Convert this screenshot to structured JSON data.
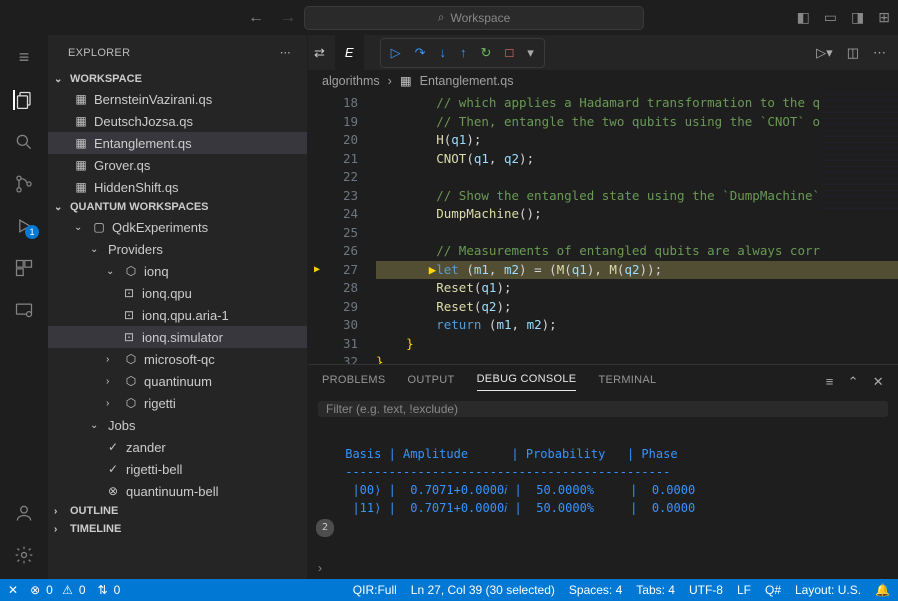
{
  "titlebar": {
    "search_placeholder": "Workspace"
  },
  "sidebar": {
    "title": "EXPLORER",
    "workspace_section": "WORKSPACE",
    "files": [
      {
        "name": "BernsteinVazirani.qs"
      },
      {
        "name": "DeutschJozsa.qs"
      },
      {
        "name": "Entanglement.qs",
        "selected": true
      },
      {
        "name": "Grover.qs"
      },
      {
        "name": "HiddenShift.qs"
      }
    ],
    "quantum_section": "QUANTUM WORKSPACES",
    "qws_root": "QdkExperiments",
    "providers_label": "Providers",
    "providers": [
      {
        "name": "ionq",
        "expanded": true,
        "children": [
          "ionq.qpu",
          "ionq.qpu.aria-1",
          "ionq.simulator"
        ],
        "selected_child": "ionq.simulator"
      },
      {
        "name": "microsoft-qc"
      },
      {
        "name": "quantinuum"
      },
      {
        "name": "rigetti"
      }
    ],
    "jobs_label": "Jobs",
    "jobs": [
      {
        "name": "zander",
        "status": "ok"
      },
      {
        "name": "rigetti-bell",
        "status": "ok"
      },
      {
        "name": "quantinuum-bell",
        "status": "fail"
      }
    ],
    "outline_label": "OUTLINE",
    "timeline_label": "TIMELINE"
  },
  "activity_badge": "1",
  "editor": {
    "tab_label": "E",
    "breadcrumb": [
      "algorithms",
      "Entanglement.qs"
    ],
    "lines": [
      {
        "n": 18,
        "html": "        <span class='tok-c'>// which applies a Hadamard transformation to the q</span>"
      },
      {
        "n": 19,
        "html": "        <span class='tok-c'>// Then, entangle the two qubits using the `CNOT` o</span>"
      },
      {
        "n": 20,
        "html": "        <span class='tok-fn'>H</span><span class='tok-p'>(</span><span class='tok-v'>q1</span><span class='tok-p'>);</span>"
      },
      {
        "n": 21,
        "html": "        <span class='tok-fn'>CNOT</span><span class='tok-p'>(</span><span class='tok-v'>q1</span><span class='tok-p'>, </span><span class='tok-v'>q2</span><span class='tok-p'>);</span>"
      },
      {
        "n": 22,
        "html": ""
      },
      {
        "n": 23,
        "html": "        <span class='tok-c'>// Show the entangled state using the `DumpMachine`</span>"
      },
      {
        "n": 24,
        "html": "        <span class='tok-fn'>DumpMachine</span><span class='tok-p'>();</span>"
      },
      {
        "n": 25,
        "html": ""
      },
      {
        "n": 26,
        "html": "        <span class='tok-c'>// Measurements of entangled qubits are always corr</span>"
      },
      {
        "n": 27,
        "hl": true,
        "bp": true,
        "html": "       <span class='tok-br'>▶</span><span class='tok-kw'>let </span><span class='tok-p'>(</span><span class='tok-v'>m1</span><span class='tok-p'>, </span><span class='tok-v'>m2</span><span class='tok-p'>) = (</span><span class='tok-fn'>M</span><span class='tok-p'>(</span><span class='tok-v'>q1</span><span class='tok-p'>), </span><span class='tok-fn'>M</span><span class='tok-p'>(</span><span class='tok-v'>q2</span><span class='tok-p'>));</span>"
      },
      {
        "n": 28,
        "html": "        <span class='tok-fn'>Reset</span><span class='tok-p'>(</span><span class='tok-v'>q1</span><span class='tok-p'>);</span>"
      },
      {
        "n": 29,
        "html": "        <span class='tok-fn'>Reset</span><span class='tok-p'>(</span><span class='tok-v'>q2</span><span class='tok-p'>);</span>"
      },
      {
        "n": 30,
        "html": "        <span class='tok-kw'>return </span><span class='tok-p'>(</span><span class='tok-v'>m1</span><span class='tok-p'>, </span><span class='tok-v'>m2</span><span class='tok-p'>);</span>"
      },
      {
        "n": 31,
        "html": "    <span class='tok-br'>}</span>"
      },
      {
        "n": 32,
        "html": "<span class='tok-br'>}</span>"
      }
    ]
  },
  "panel": {
    "tabs": [
      "PROBLEMS",
      "OUTPUT",
      "DEBUG CONSOLE",
      "TERMINAL"
    ],
    "active": "DEBUG CONSOLE",
    "filter_placeholder": "Filter (e.g. text, !exclude)",
    "console_lines": [
      " Basis | Amplitude      | Probability   | Phase",
      " ---------------------------------------------",
      "  |00⟩ |  0.7071+0.0000𝑖 |  50.0000%     |  0.0000",
      "  |11⟩ |  0.7071+0.0000𝑖 |  50.0000%     |  0.0000"
    ],
    "repeat_badge": "2"
  },
  "status": {
    "errors": "0",
    "warnings": "0",
    "ports": "0",
    "qir": "QIR:Full",
    "cursor": "Ln 27, Col 39 (30 selected)",
    "spaces": "Spaces: 4",
    "enc": "UTF-8",
    "tabsize": "Tabs: 4",
    "eol": "LF",
    "lang": "Q#",
    "layout": "Layout: U.S."
  }
}
